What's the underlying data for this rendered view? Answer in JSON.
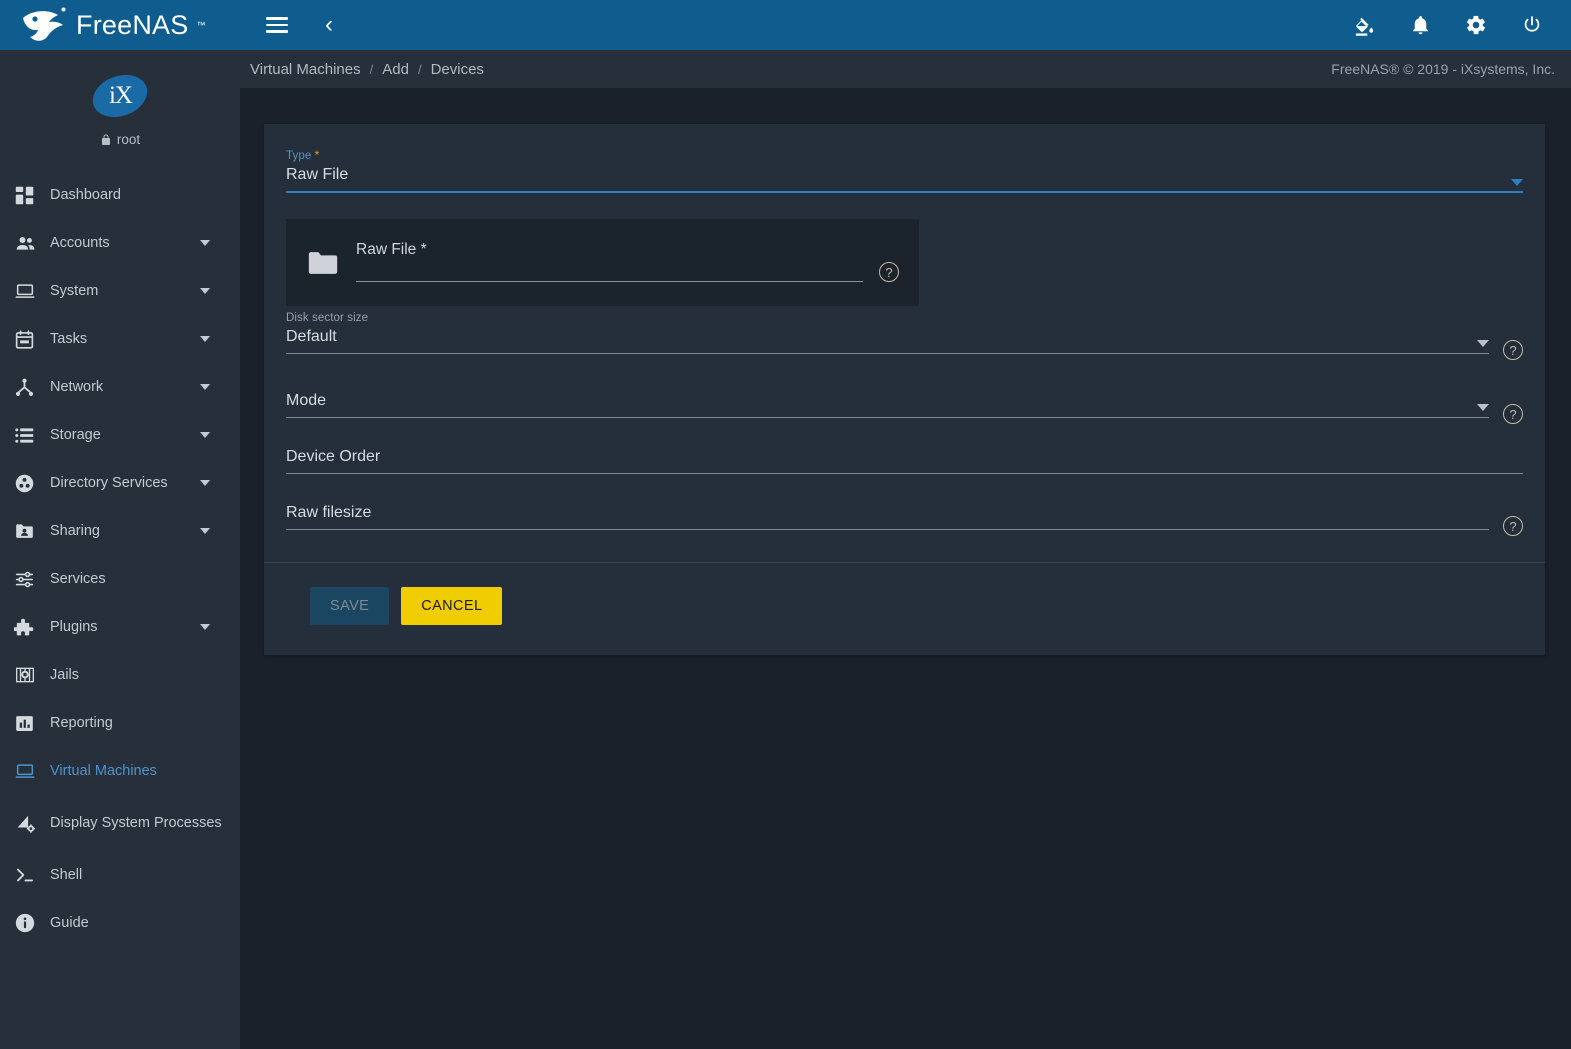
{
  "app": {
    "brand": "FreeNAS",
    "brand_tm": "™",
    "copyright": "FreeNAS® © 2019 - iXsystems, Inc."
  },
  "topbar": {
    "menu_icon": "hamburger-menu-icon",
    "back_icon": "chevron-left-icon",
    "back_glyph": "‹",
    "actions": [
      {
        "name": "theme-icon",
        "label": "Change Theme"
      },
      {
        "name": "notifications-icon",
        "label": "Notifications"
      },
      {
        "name": "settings-icon",
        "label": "Settings"
      },
      {
        "name": "power-icon",
        "label": "Power"
      }
    ]
  },
  "sidebar": {
    "avatar_text": "iX",
    "user": "root",
    "lock_icon": "lock-icon",
    "items": [
      {
        "label": "Dashboard",
        "icon": "dashboard-icon",
        "expandable": false,
        "active": false
      },
      {
        "label": "Accounts",
        "icon": "accounts-icon",
        "expandable": true,
        "active": false
      },
      {
        "label": "System",
        "icon": "system-icon",
        "expandable": true,
        "active": false
      },
      {
        "label": "Tasks",
        "icon": "tasks-icon",
        "expandable": true,
        "active": false
      },
      {
        "label": "Network",
        "icon": "network-icon",
        "expandable": true,
        "active": false
      },
      {
        "label": "Storage",
        "icon": "storage-icon",
        "expandable": true,
        "active": false
      },
      {
        "label": "Directory Services",
        "icon": "directory-services-icon",
        "expandable": true,
        "active": false
      },
      {
        "label": "Sharing",
        "icon": "sharing-icon",
        "expandable": true,
        "active": false
      },
      {
        "label": "Services",
        "icon": "services-icon",
        "expandable": false,
        "active": false
      },
      {
        "label": "Plugins",
        "icon": "plugins-icon",
        "expandable": true,
        "active": false
      },
      {
        "label": "Jails",
        "icon": "jails-icon",
        "expandable": false,
        "active": false
      },
      {
        "label": "Reporting",
        "icon": "reporting-icon",
        "expandable": false,
        "active": false
      },
      {
        "label": "Virtual Machines",
        "icon": "virtual-machines-icon",
        "expandable": false,
        "active": true
      },
      {
        "label": "Display System Processes",
        "icon": "display-system-processes-icon",
        "expandable": false,
        "active": false
      },
      {
        "label": "Shell",
        "icon": "shell-icon",
        "expandable": false,
        "active": false
      },
      {
        "label": "Guide",
        "icon": "guide-icon",
        "expandable": false,
        "active": false
      }
    ]
  },
  "breadcrumb": {
    "items": [
      "Virtual Machines",
      "Add",
      "Devices"
    ],
    "separator": "/"
  },
  "form": {
    "type_field": {
      "label": "Type",
      "required_marker": "*",
      "value": "Raw File",
      "focused": true
    },
    "raw_file_panel": {
      "folder_icon": "folder-icon",
      "label": "Raw File *",
      "value": "",
      "help_icon": "help-icon",
      "help_glyph": "?"
    },
    "fields": [
      {
        "name": "disk-sector-size",
        "mini_label": "Disk sector size",
        "value": "Default",
        "placeholder": "",
        "has_dropdown": true,
        "has_help": true,
        "filled": true
      },
      {
        "name": "mode",
        "mini_label": "",
        "value": "",
        "placeholder": "Mode",
        "has_dropdown": true,
        "has_help": true,
        "filled": false
      },
      {
        "name": "device-order",
        "mini_label": "",
        "value": "",
        "placeholder": "Device Order",
        "has_dropdown": false,
        "has_help": false,
        "filled": false
      },
      {
        "name": "raw-filesize",
        "mini_label": "",
        "value": "",
        "placeholder": "Raw filesize",
        "has_dropdown": false,
        "has_help": true,
        "filled": false
      }
    ],
    "buttons": {
      "save": "SAVE",
      "save_disabled": true,
      "cancel": "CANCEL"
    }
  },
  "colors": {
    "topbar": "#0f5c8f",
    "sidebar": "#262f3a",
    "page_bg": "#1a212b",
    "card_bg": "#242f3b",
    "subpanel_bg": "#1b232d",
    "accent_blue": "#4f94cd",
    "focus_blue": "#2c7fbe",
    "required_star": "#e0a525",
    "cancel_yellow": "#f0cd00",
    "save_disabled_bg": "#1b4662"
  }
}
